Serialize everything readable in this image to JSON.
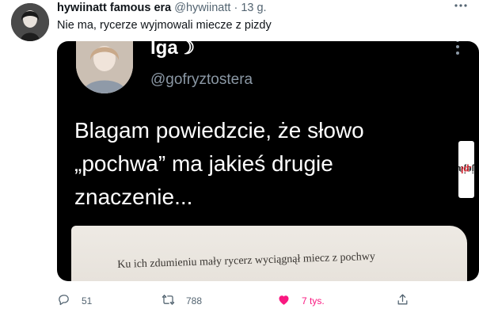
{
  "author": {
    "name": "hywiinatt famous era",
    "handle": "@hywiinatt",
    "separator": "·",
    "time": "13 g."
  },
  "more_icon": "more-horizontal-icon",
  "tweet_text": "Nie ma, rycerze wyjmowali miecze z pizdy",
  "embedded": {
    "name": "Iga☽",
    "handle": "@gofryztostera",
    "text": "Blagam powiedzcie, że słowo „pochwa” ma jakieś drugie znaczenie...",
    "book_text": "Ku ich zdumieniu mały rycerz wyciągnął miecz z pochwy"
  },
  "watermark": {
    "brand": "jeja",
    "tld": ".pl"
  },
  "actions": {
    "reply_count": "51",
    "retweet_count": "788",
    "like_count": "7 tys.",
    "icons": [
      "reply-icon",
      "retweet-icon",
      "heart-icon",
      "share-icon"
    ]
  },
  "colors": {
    "like": "#f91880",
    "muted": "#536471",
    "media_bg": "#000000",
    "watermark_accent": "#d4202c"
  }
}
